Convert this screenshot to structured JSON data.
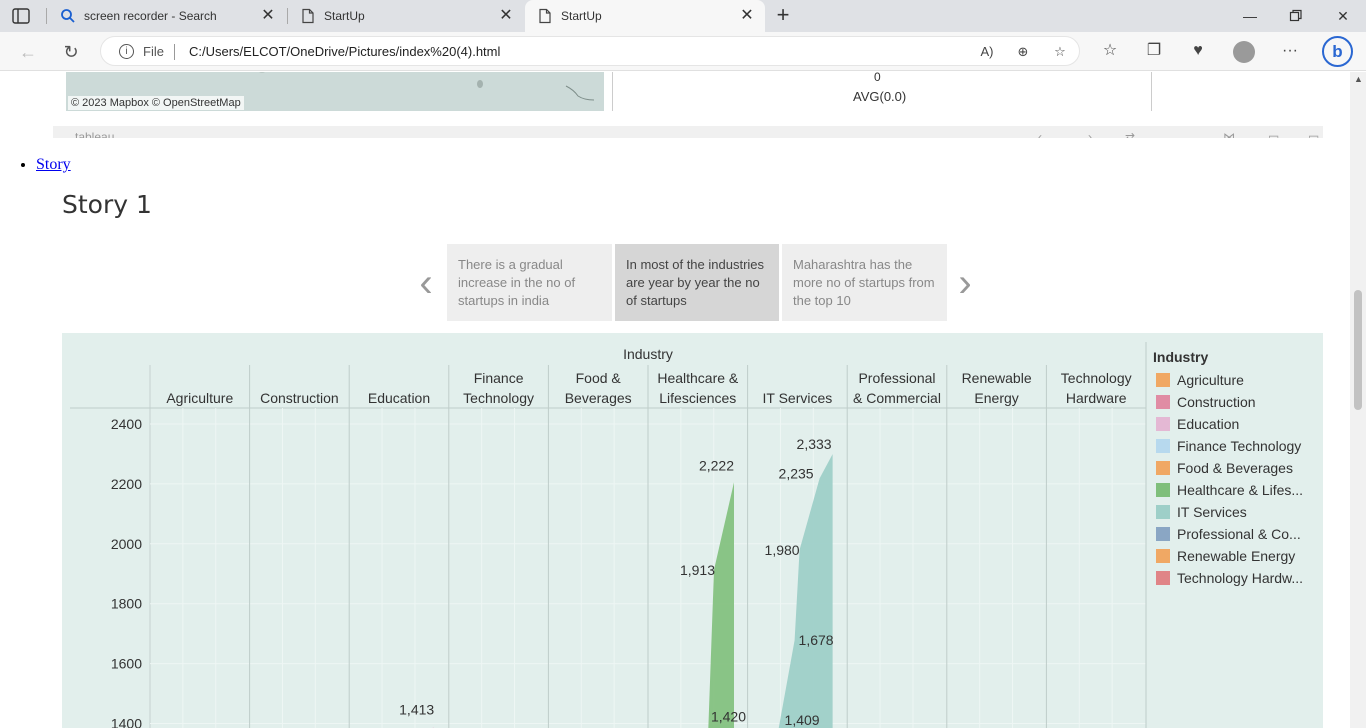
{
  "browser": {
    "tabs": [
      {
        "title": "screen recorder - Search",
        "icon": "search-icon",
        "active": false
      },
      {
        "title": "StartUp",
        "icon": "page-icon",
        "active": false
      },
      {
        "title": "StartUp",
        "icon": "page-icon",
        "active": true
      }
    ],
    "address": {
      "prefix": "File",
      "url": "C:/Users/ELCOT/OneDrive/Pictures/index%20(4).html"
    }
  },
  "page": {
    "map_credit": "© 2023 Mapbox  © OpenStreetMap",
    "panel_zero": "0",
    "panel_avg": "AVG(0.0)",
    "toolbar_brand": "tableau",
    "nav_link": "Story",
    "story_title": "Story 1",
    "captions": [
      {
        "text": "There is a gradual increase in the no of startups in india",
        "active": false
      },
      {
        "text": "In  most of the industries are year by year the no of startups",
        "active": true
      },
      {
        "text": "Maharashtra has the more no of startups from the top 10",
        "active": false
      }
    ]
  },
  "chart_data": {
    "type": "area",
    "title": "Industry",
    "legend_title": "Industry",
    "categories": [
      "Agriculture",
      "Construction",
      "Education",
      "Finance Technology",
      "Food & Beverages",
      "Healthcare & Lifesciences",
      "IT Services",
      "Professional & Commercial",
      "Renewable Energy",
      "Technology Hardware"
    ],
    "column_headers": [
      [
        "Agriculture"
      ],
      [
        "Construction"
      ],
      [
        "Education"
      ],
      [
        "Finance",
        "Technology"
      ],
      [
        "Food &",
        "Beverages"
      ],
      [
        "Healthcare &",
        "Lifesciences"
      ],
      [
        "IT Services"
      ],
      [
        "Professional",
        "& Commercial"
      ],
      [
        "Renewable",
        "Energy"
      ],
      [
        "Technology",
        "Hardware"
      ]
    ],
    "legend": [
      {
        "label": "Agriculture",
        "color": "#f0a864"
      },
      {
        "label": "Construction",
        "color": "#e08ca4"
      },
      {
        "label": "Education",
        "color": "#e4b8d4"
      },
      {
        "label": "Finance Technology",
        "color": "#b7d9ee"
      },
      {
        "label": "Food & Beverages",
        "color": "#f0a864"
      },
      {
        "label": "Healthcare & Lifes...",
        "color": "#7fbf7b"
      },
      {
        "label": "IT Services",
        "color": "#9ecfc8"
      },
      {
        "label": "Professional & Co...",
        "color": "#8aa6c4"
      },
      {
        "label": "Renewable Energy",
        "color": "#f0a864"
      },
      {
        "label": "Technology Hardw...",
        "color": "#e08487"
      }
    ],
    "yaxis": {
      "ticks": [
        2400,
        2200,
        2000,
        1800,
        1600,
        1400
      ],
      "visible_range": [
        1390,
        2460
      ]
    },
    "series": [
      {
        "category": "Education",
        "color": "#e4b8d4",
        "labels": [
          1413
        ]
      },
      {
        "category": "Healthcare & Lifesciences",
        "color": "#7fbf7b",
        "labels": [
          1420,
          1913,
          2222
        ]
      },
      {
        "category": "IT Services",
        "color": "#9ecfc8",
        "labels": [
          1409,
          1678,
          1980,
          2235,
          2333
        ]
      }
    ]
  }
}
